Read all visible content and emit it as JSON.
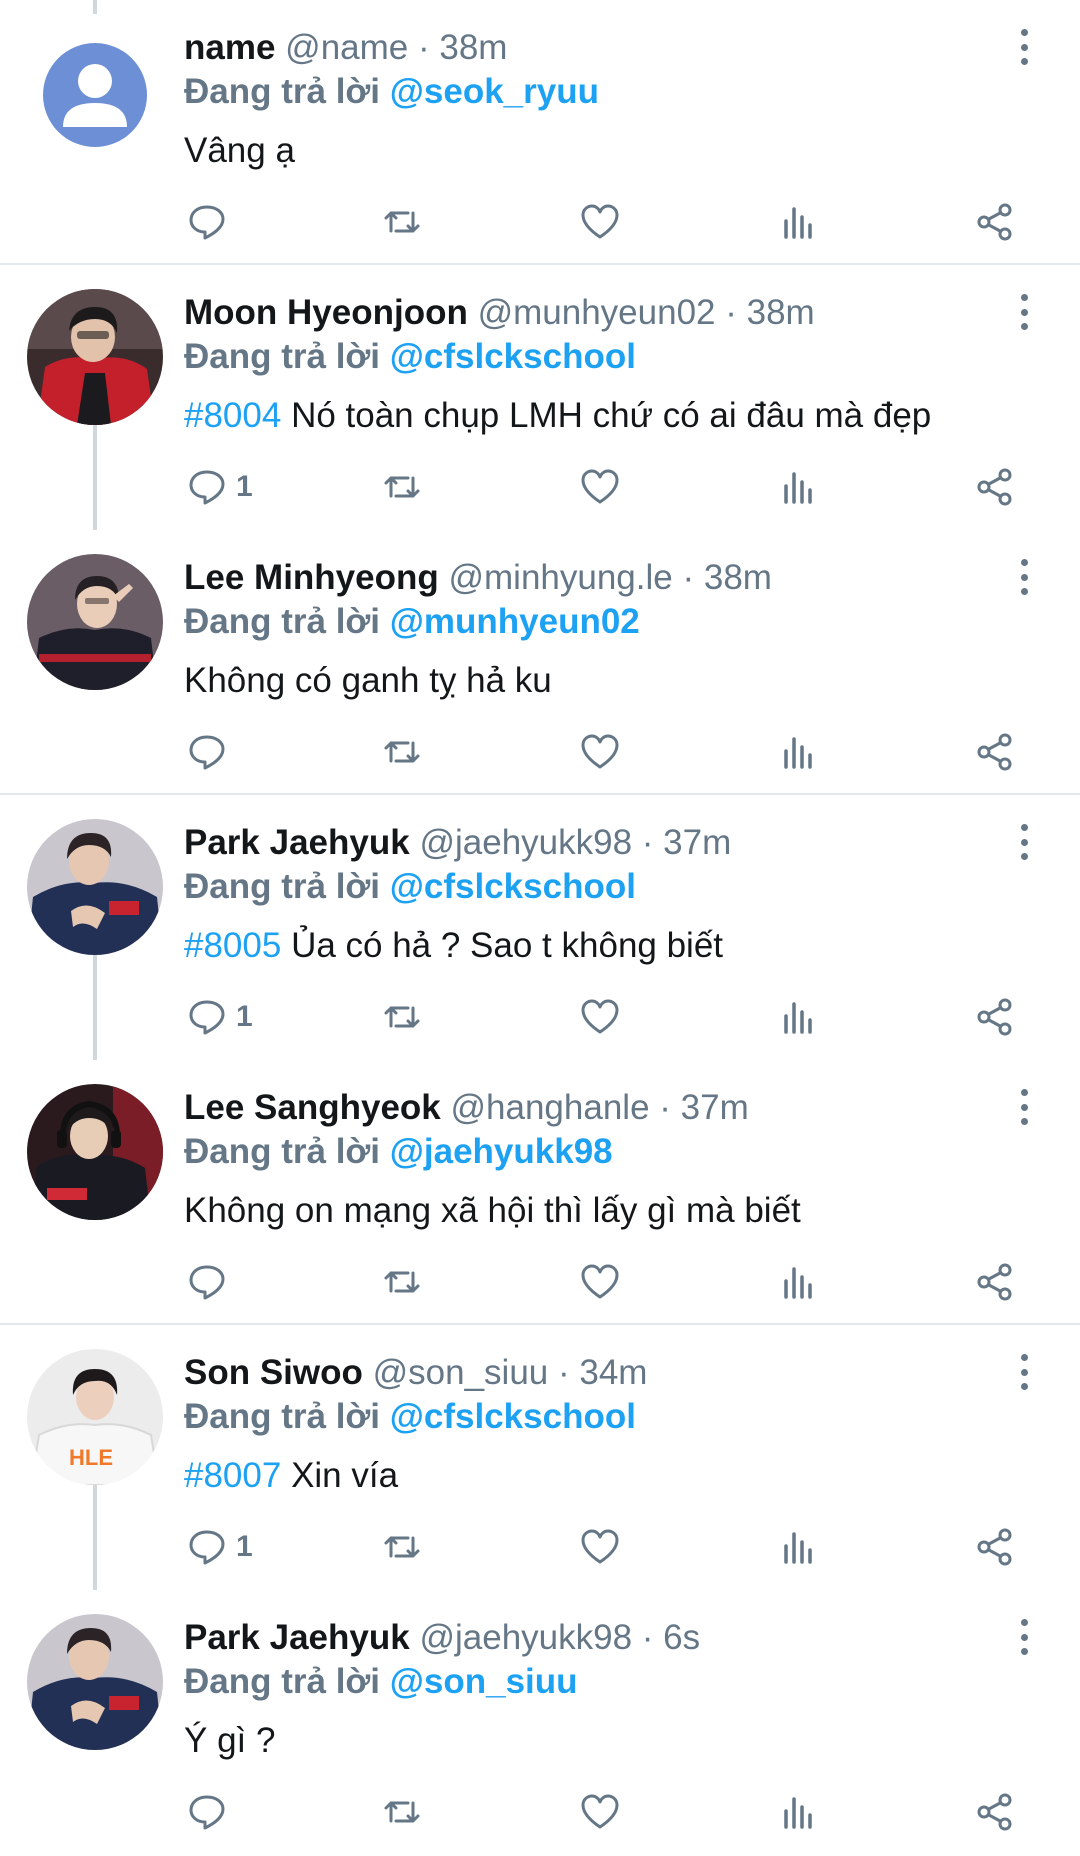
{
  "replying_prefix": "Đang trả lời",
  "colors": {
    "link": "#1da1f2",
    "secondary_text": "#657786",
    "primary_text": "#14171a",
    "thread_line": "#d0d8de",
    "divider": "#e3e8ec"
  },
  "tweets": [
    {
      "display_name": "name",
      "handle": "@name",
      "time": "38m",
      "replying_to": "@seok_ryuu",
      "hashtag": "",
      "text": "Vâng ạ",
      "reply_count": "",
      "avatar": "default-user-icon"
    },
    {
      "display_name": "Moon Hyeonjoon",
      "handle": "@munhyeun02",
      "time": "38m",
      "replying_to": "@cfslckschool",
      "hashtag": "#8004",
      "text": "Nó toàn chụp LMH chứ có ai đâu mà đẹp",
      "reply_count": "1",
      "avatar": "photo-red-jacket"
    },
    {
      "display_name": "Lee Minhyeong",
      "handle": "@minhyung.le",
      "time": "38m",
      "replying_to": "@munhyeun02",
      "hashtag": "",
      "text": "Không có ganh tỵ hả ku",
      "reply_count": "",
      "avatar": "photo-dark-jersey"
    },
    {
      "display_name": "Park Jaehyuk",
      "handle": "@jaehyukk98",
      "time": "37m",
      "replying_to": "@cfslckschool",
      "hashtag": "#8005",
      "text": "Ủa có hả ? Sao t không biết",
      "reply_count": "1",
      "avatar": "photo-navy-jersey"
    },
    {
      "display_name": "Lee Sanghyeok",
      "handle": "@hanghanle",
      "time": "37m",
      "replying_to": "@jaehyukk98",
      "hashtag": "",
      "text": "Không on mạng xã hội thì lấy gì mà biết",
      "reply_count": "",
      "avatar": "photo-headset"
    },
    {
      "display_name": "Son Siwoo",
      "handle": "@son_siuu",
      "time": "34m",
      "replying_to": "@cfslckschool",
      "hashtag": "#8007",
      "text": "Xin vía",
      "reply_count": "1",
      "avatar": "photo-white-jersey"
    },
    {
      "display_name": "Park Jaehyuk",
      "handle": "@jaehyukk98",
      "time": "6s",
      "replying_to": "@son_siuu",
      "hashtag": "",
      "text": "Ý gì ?",
      "reply_count": "",
      "avatar": "photo-navy-jersey"
    }
  ]
}
